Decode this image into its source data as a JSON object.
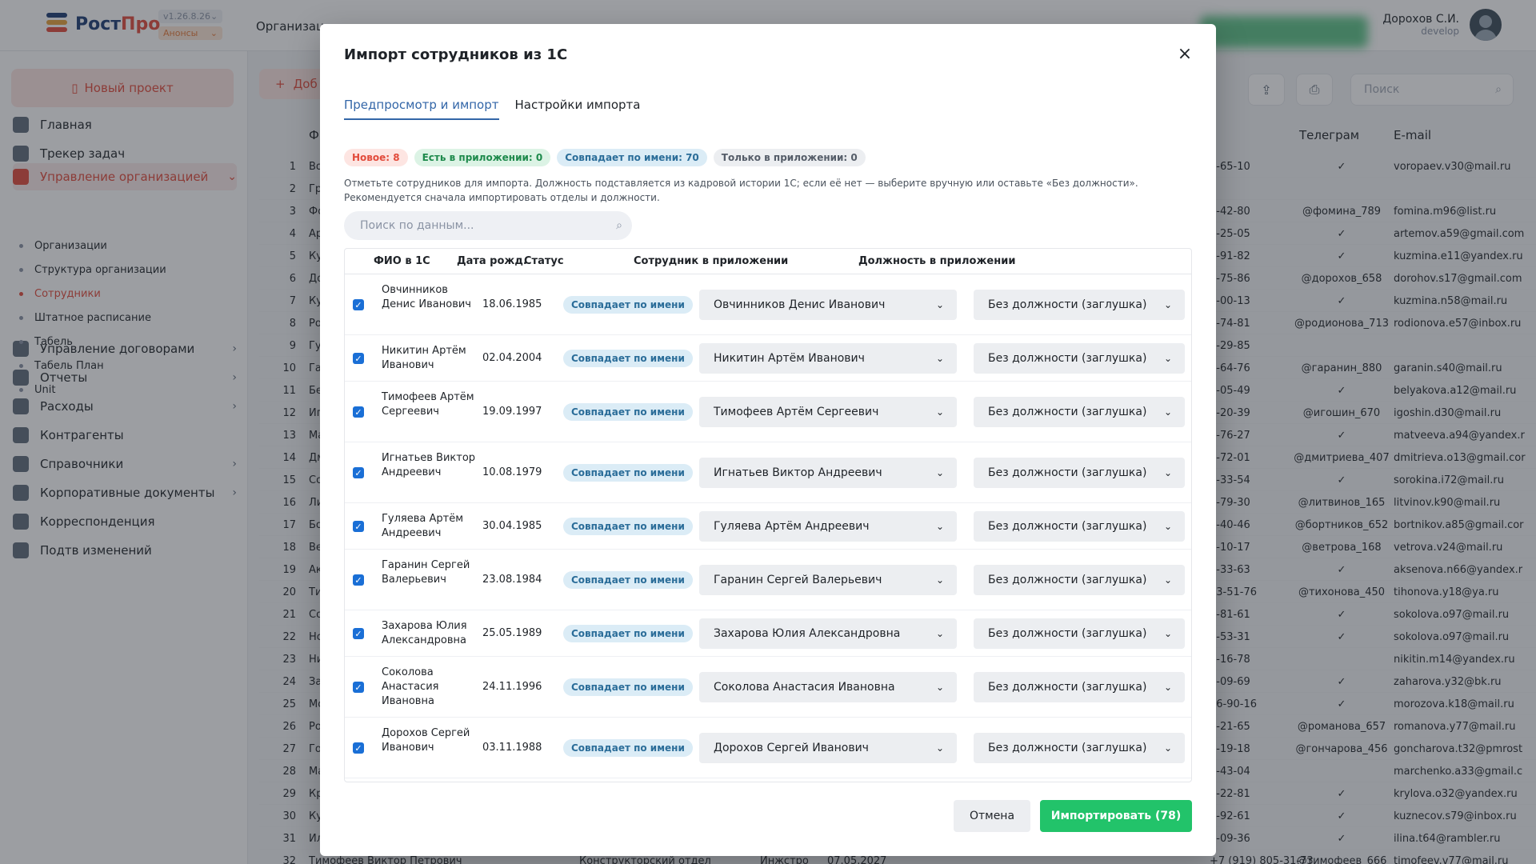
{
  "app": {
    "logo_main": "Рост",
    "logo_accent": "Про",
    "version": "v1.26.8.26",
    "announces": "Анонсы",
    "top_nav_first": "Организац",
    "user_name": "Дорохов С.И.",
    "user_role": "develop",
    "new_project": "Новый проект",
    "add_label": "Доб",
    "bg_search_placeholder": "Поиск"
  },
  "sidebar": {
    "items": [
      {
        "label": "Главная",
        "icon": "home-icon"
      },
      {
        "label": "Трекер задач",
        "icon": "tasks-icon"
      },
      {
        "label": "Управление организацией",
        "icon": "org-icon"
      },
      {
        "label": "Управление договорами",
        "icon": "contracts-icon"
      },
      {
        "label": "Отчеты",
        "icon": "reports-icon"
      },
      {
        "label": "Расходы",
        "icon": "expenses-icon"
      },
      {
        "label": "Контрагенты",
        "icon": "contractors-icon"
      },
      {
        "label": "Справочники",
        "icon": "reference-icon"
      },
      {
        "label": "Корпоративные документы",
        "icon": "documents-icon"
      },
      {
        "label": "Корреспонденция",
        "icon": "mail-icon"
      },
      {
        "label": "Подтв изменений",
        "icon": "info-icon"
      }
    ],
    "subitems": [
      "Организации",
      "Структура организации",
      "Сотрудники",
      "Штатное расписание",
      "Табель",
      "Табель План",
      "Unit"
    ]
  },
  "background_table": {
    "headers": {
      "fio": "Ф",
      "telegram": "Телеграм",
      "email": "E-mail"
    },
    "last_row": {
      "num": "32",
      "fio": "Тимофеев Виктор Петрович",
      "dep": "Конструкторский отдел",
      "pos": "Инжстро",
      "date": "07.05.2027",
      "phone": "+7 (919) 805-31-73",
      "tg": "@тимофеев_666",
      "mail": "timofeev.v77@mail.ru"
    },
    "rows": [
      {
        "num": "1",
        "fio": "Во",
        "phone": "7-65-10",
        "tg": "✓",
        "mail": "voropaev.v30@mail.ru"
      },
      {
        "num": "2",
        "fio": "Гр",
        "phone": "",
        "tg": "",
        "mail": ""
      },
      {
        "num": "3",
        "fio": "Фо",
        "phone": "3-42-80",
        "tg": "@фомина_789",
        "mail": "fomina.m96@list.ru"
      },
      {
        "num": "4",
        "fio": "Ар",
        "phone": "7-25-05",
        "tg": "✓",
        "mail": "artemov.a59@gmail.com"
      },
      {
        "num": "5",
        "fio": "Ку",
        "phone": "4-91-82",
        "tg": "✓",
        "mail": "kuzmina.e11@yandex.ru"
      },
      {
        "num": "6",
        "fio": "До",
        "phone": "5-75-86",
        "tg": "@дорохов_658",
        "mail": "dorohov.s17@gmail.com"
      },
      {
        "num": "7",
        "fio": "Ку",
        "phone": "4-00-13",
        "tg": "✓",
        "mail": "kuzmina.n58@mail.ru"
      },
      {
        "num": "8",
        "fio": "Ро",
        "phone": "0-74-81",
        "tg": "@родионова_713",
        "mail": "rodionova.e57@inbox.ru"
      },
      {
        "num": "9",
        "fio": "Гу",
        "phone": "5-29-85",
        "tg": "",
        "mail": ""
      },
      {
        "num": "10",
        "fio": "Га",
        "phone": "8-64-76",
        "tg": "@гаранин_880",
        "mail": "garanin.s40@mail.ru"
      },
      {
        "num": "11",
        "fio": "Бе",
        "phone": "0-05-49",
        "tg": "✓",
        "mail": "belyakova.a12@mail.ru"
      },
      {
        "num": "12",
        "fio": "Иг",
        "phone": "2-20-39",
        "tg": "@игошин_670",
        "mail": "igoshin.d30@mail.ru"
      },
      {
        "num": "13",
        "fio": "Ма",
        "phone": "5-76-27",
        "tg": "✓",
        "mail": "matveeva.a94@yandex.r"
      },
      {
        "num": "14",
        "fio": "Дм",
        "phone": "2-72-01",
        "tg": "@дмитриева_407",
        "mail": "dmitrieva.o13@gmail.cor"
      },
      {
        "num": "15",
        "fio": "Со",
        "phone": "7-33-54",
        "tg": "✓",
        "mail": "sorokina.i72@mail.ru"
      },
      {
        "num": "16",
        "fio": "Ли",
        "phone": "6-79-30",
        "tg": "@литвинов_165",
        "mail": "litvinov.k90@mail.ru"
      },
      {
        "num": "17",
        "fio": "Бо",
        "phone": "3-40-46",
        "tg": "@бортников_652",
        "mail": "bortnikov.a85@gmail.cor"
      },
      {
        "num": "18",
        "fio": "Ве",
        "phone": "1-10-17",
        "tg": "@ветрова_168",
        "mail": "vetrova.v24@mail.ru"
      },
      {
        "num": "19",
        "fio": "Ак",
        "phone": "7-33-63",
        "tg": "✓",
        "mail": "aksenova.n66@yandex.r"
      },
      {
        "num": "20",
        "fio": "Ти",
        "phone": "03-51-76",
        "tg": "@тихонова_450",
        "mail": "tihonova.y18@ya.ru"
      },
      {
        "num": "21",
        "fio": "Со",
        "phone": "4-81-61",
        "tg": "✓",
        "mail": "sokolova.o97@mail.ru"
      },
      {
        "num": "22",
        "fio": "Нс",
        "phone": "0-53-31",
        "tg": "✓",
        "mail": "sokolova.o97@mail.ru"
      },
      {
        "num": "23",
        "fio": "Ни",
        "phone": "4-16-78",
        "tg": "",
        "mail": "nikitin.m14@yandex.ru"
      },
      {
        "num": "24",
        "fio": "За",
        "phone": "3-09-69",
        "tg": "✓",
        "mail": "zaharova.y32@bk.ru"
      },
      {
        "num": "25",
        "fio": "Мо",
        "phone": "06-90-16",
        "tg": "✓",
        "mail": "morozova.k18@mail.ru"
      },
      {
        "num": "26",
        "fio": "Ро",
        "phone": "5-21-65",
        "tg": "@романова_657",
        "mail": "romanova.y77@mail.ru"
      },
      {
        "num": "27",
        "fio": "Го",
        "phone": "9-19-18",
        "tg": "@гончарова_456",
        "mail": "goncharova.t32@pmrost"
      },
      {
        "num": "28",
        "fio": "Ма",
        "phone": "3-43-04",
        "tg": "",
        "mail": "marchenko.a33@gmail.c"
      },
      {
        "num": "29",
        "fio": "Кр",
        "phone": "2-22-81",
        "tg": "✓",
        "mail": "krylova.o32@yandex.ru"
      },
      {
        "num": "30",
        "fio": "Ку",
        "phone": "5-92-61",
        "tg": "✓",
        "mail": "kuznecov.s79@inbox.ru"
      },
      {
        "num": "31",
        "fio": "Ил",
        "phone": "9-09-36",
        "tg": "✓",
        "mail": "ilina.t64@rambler.ru"
      }
    ]
  },
  "modal": {
    "title": "Импорт сотрудников из 1С",
    "close": "×",
    "tabs": [
      "Предпросмотр и импорт",
      "Настройки импорта"
    ],
    "badges": {
      "new": "Новое: 8",
      "in_app": "Есть в приложении: 0",
      "match": "Совпадает по имени: 70",
      "only_app": "Только в приложении: 0"
    },
    "hint": "Отметьте сотрудников для импорта. Должность подставляется из кадровой истории 1С; если её нет — выберите вручную или оставьте «Без должности». Рекомендуется сначала импортировать отделы и должности.",
    "search_placeholder": "Поиск по данным...",
    "columns": {
      "fio": "ФИО в 1С",
      "dob": "Дата рожд.",
      "status": "Статус",
      "employee": "Сотрудник в приложении",
      "position": "Должность в приложении"
    },
    "rows": [
      {
        "fio": "Овчинников Денис Иванович",
        "dob": "18.06.1985",
        "status": "Совпадает по имени",
        "employee": "Овчинников Денис Иванович",
        "position": "Без должности (заглушка)"
      },
      {
        "fio": "Никитин Артём Иванович",
        "dob": "02.04.2004",
        "status": "Совпадает по имени",
        "employee": "Никитин Артём Иванович",
        "position": "Без должности (заглушка)"
      },
      {
        "fio": "Тимофеев Артём Сергеевич",
        "dob": "19.09.1997",
        "status": "Совпадает по имени",
        "employee": "Тимофеев Артём Сергеевич",
        "position": "Без должности (заглушка)"
      },
      {
        "fio": "Игнатьев Виктор Андреевич",
        "dob": "10.08.1979",
        "status": "Совпадает по имени",
        "employee": "Игнатьев Виктор Андреевич",
        "position": "Без должности (заглушка)"
      },
      {
        "fio": "Гуляева Артём Андреевич",
        "dob": "30.04.1985",
        "status": "Совпадает по имени",
        "employee": "Гуляева Артём Андреевич",
        "position": "Без должности (заглушка)"
      },
      {
        "fio": "Гаранин Сергей Валерьевич",
        "dob": "23.08.1984",
        "status": "Совпадает по имени",
        "employee": "Гаранин Сергей Валерьевич",
        "position": "Без должности (заглушка)"
      },
      {
        "fio": "Захарова Юлия Александровна",
        "dob": "25.05.1989",
        "status": "Совпадает по имени",
        "employee": "Захарова Юлия Александровна",
        "position": "Без должности (заглушка)"
      },
      {
        "fio": "Соколова Анастасия Ивановна",
        "dob": "24.11.1996",
        "status": "Совпадает по имени",
        "employee": "Соколова Анастасия Ивановна",
        "position": "Без должности (заглушка)"
      },
      {
        "fio": "Дорохов Сергей Иванович",
        "dob": "03.11.1988",
        "status": "Совпадает по имени",
        "employee": "Дорохов Сергей Иванович",
        "position": "Без должности (заглушка)"
      }
    ],
    "cancel": "Отмена",
    "import": "Импортировать (78)"
  },
  "colors": {
    "accent_red": "#e24b3b",
    "accent_blue": "#3366a8",
    "import_green": "#22c36a",
    "checkbox_blue": "#1a6fd6"
  }
}
